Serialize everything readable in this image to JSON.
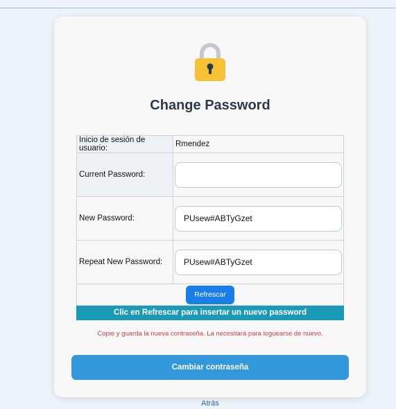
{
  "colors": {
    "page_background": "#edf4fc",
    "card_background": "#f8f8f9",
    "lock_body": "#f7c234",
    "lock_shackle": "#c5c8cc",
    "refresh_button": "#1a7ee8",
    "banner": "#1b9ab8",
    "note_text": "#d23f3f",
    "submit_button": "#3397dc",
    "link": "#2c66a8"
  },
  "icons": {
    "lock": "lock-icon"
  },
  "header": {
    "title": "Change Password"
  },
  "form": {
    "user_label": "Inicio de sesión de usuario:",
    "user_value": "Rmendez",
    "current_password_label": "Current Password:",
    "current_password_value": "",
    "new_password_label": "New Password:",
    "new_password_value": "PUsew#ABTyGzet",
    "repeat_password_label": "Repeat New Password:",
    "repeat_password_value": "PUsew#ABTyGzet",
    "refresh_label": "Refrescar",
    "refresh_hint": "Clic en Refrescar para insertar un nuevo password"
  },
  "note": "Copie y guarda la nueva contraseña. La necesitará para loguearse de nuevo.",
  "submit_label": "Cambiar contraseña",
  "back_label": "Atrás"
}
